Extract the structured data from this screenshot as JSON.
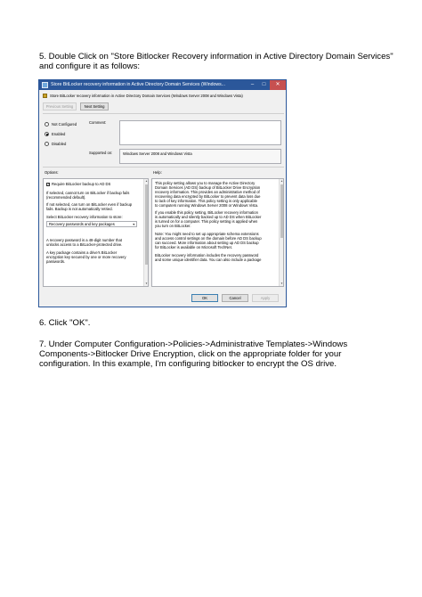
{
  "step5": {
    "line1": "5.  Double Click on \"Store Bitlocker Recovery information in Active Directory Domain Services\"",
    "line2": "and configure it as follows:"
  },
  "dialog": {
    "title": "Store BitLocker recovery information in Active Directory Domain Services (Windows...",
    "policy_name": "Store BitLocker recovery information in Active Directory Domain Services (Windows Server 2008 and Windows Vista)",
    "previous_setting": "Previous Setting",
    "next_setting": "Next Setting",
    "radio_not_configured": "Not Configured",
    "radio_enabled": "Enabled",
    "radio_disabled": "Disabled",
    "comment_label": "Comment:",
    "supported_on_label": "Supported on:",
    "supported_on_value": "Windows Server 2008 and Windows Vista",
    "options_label": "Options:",
    "help_label": "Help:",
    "options": {
      "require_backup_label": "Require BitLocker backup to AD DS",
      "lines": [
        "If selected, cannot turn on BitLocker if backup fails",
        "(recommended default).",
        "If not selected, can turn on BitLocker even if backup",
        "fails. Backup is not automatically retried.",
        "Select BitLocker recovery information to store:"
      ],
      "select_value": "Recovery passwords and key packages",
      "lower_lines": [
        "A recovery password is a 48-digit number that",
        "unlocks access to a BitLocker-protected drive.",
        "A key package contains a drive's BitLocker",
        "encryption key secured by one or more recovery",
        "passwords."
      ]
    },
    "help_lines": [
      "This policy setting allows you to manage the Active Directory",
      "Domain Services (AD DS) backup of BitLocker Drive Encryption",
      "recovery information. This provides an administrative method of",
      "recovering data encrypted by BitLocker to prevent data loss due",
      "to lack of key information. This policy setting is only applicable",
      "to computers running Windows Server 2008 or Windows Vista.",
      "If you enable this policy setting, BitLocker recovery information",
      "is automatically and silently backed up to AD DS when BitLocker",
      "is turned on for a computer. This policy setting is applied when",
      "you turn on BitLocker.",
      "Note: You might need to set up appropriate schema extensions",
      "and access control settings on the domain before AD DS backup",
      "can succeed. More information about setting up AD DS backup",
      "for BitLocker is available on Microsoft TechNet.",
      "BitLocker recovery information includes the recovery password",
      "and some unique identifier data. You can also include a package"
    ],
    "ok": "OK",
    "cancel": "Cancel",
    "apply": "Apply"
  },
  "step6": "6.  Click \"OK\".",
  "step7": {
    "line1": "7.  Under Computer Configuration->Policies->Administrative Templates->Windows",
    "line2": "Components->Bitlocker Drive Encryption, click on the appropriate folder for your",
    "line3": "configuration.  In this example, I'm configuring bitlocker to encrypt the OS drive."
  }
}
